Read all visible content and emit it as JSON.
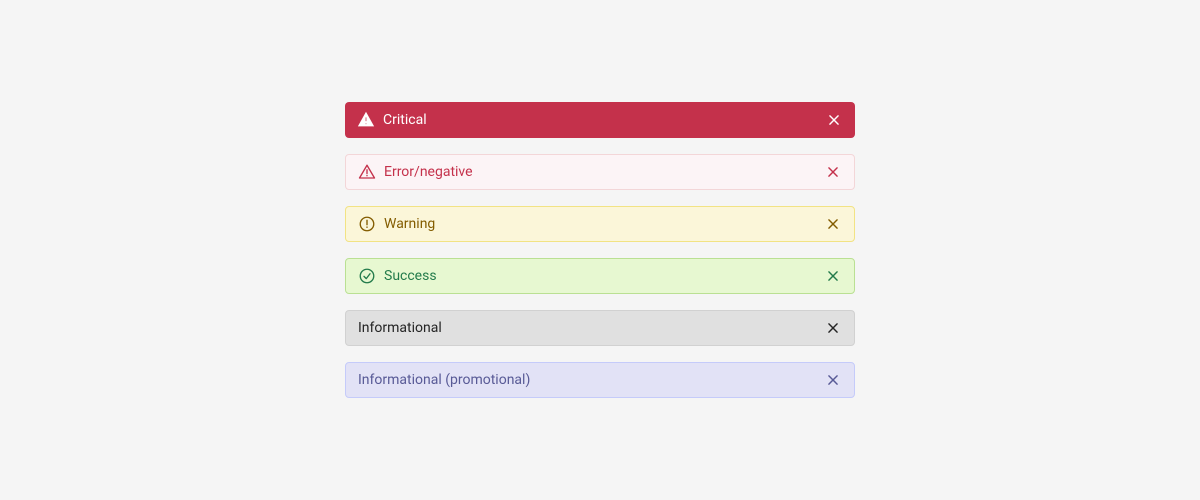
{
  "banners": [
    {
      "variant": "critical",
      "label": "Critical",
      "icon": "warning-triangle-solid-icon",
      "colors": {
        "bg": "#c4314b",
        "text": "#ffffff"
      }
    },
    {
      "variant": "error",
      "label": "Error/negative",
      "icon": "warning-triangle-icon",
      "colors": {
        "bg": "#fcf4f6",
        "text": "#c4314b",
        "border": "#f3d6d8"
      }
    },
    {
      "variant": "warning",
      "label": "Warning",
      "icon": "exclamation-circle-icon",
      "colors": {
        "bg": "#fbf6d9",
        "text": "#835c00",
        "border": "#f2e384"
      }
    },
    {
      "variant": "success",
      "label": "Success",
      "icon": "checkmark-circle-icon",
      "colors": {
        "bg": "#e7f8d1",
        "text": "#237b4b",
        "border": "#bae093"
      }
    },
    {
      "variant": "info",
      "label": "Informational",
      "icon": "none",
      "colors": {
        "bg": "#e0e0e0",
        "text": "#242424",
        "border": "#d1d1d1"
      }
    },
    {
      "variant": "promo",
      "label": "Informational (promotional)",
      "icon": "none",
      "colors": {
        "bg": "#e2e2f6",
        "text": "#585a96",
        "border": "#c5cbfa"
      }
    }
  ]
}
